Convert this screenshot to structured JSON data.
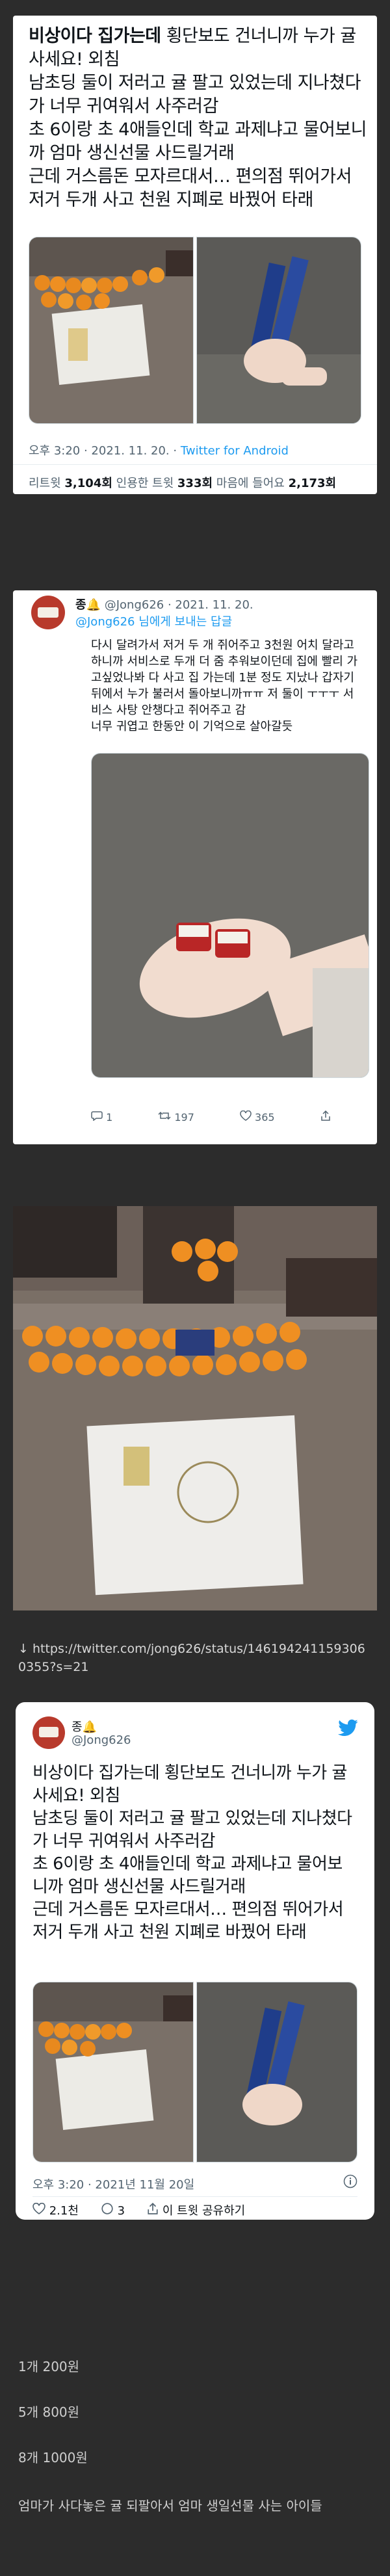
{
  "tweet1": {
    "text_bold": "비상이다 집가는데",
    "text_rest": " 횡단보도 건너니까 누가 귤사세요! 외침\n남초딩 둘이 저러고 귤 팔고 있었는데 지나쳤다가 너무 귀여워서 사주러감\n초 6이랑 초 4애들인데 학교 과제냐고 물어보니까 엄마 생신선물 사드릴거래\n근데 거스름돈 모자르대서… 편의점 뛰어가서 저거 두개 사고 천원 지폐로 바꿨어 타래",
    "timestamp": "오후 3:20 · 2021. 11. 20. · ",
    "source": "Twitter for Android",
    "retweets_count": "3,104회",
    "retweets_label": " 리트윗 ",
    "quotes_count": "333회",
    "quotes_label": " 인용한 트윗 ",
    "likes_count": "2,173회",
    "likes_label": " 마음에 들어요 "
  },
  "reply": {
    "name": "종🔔",
    "handle": "@Jong626 · 2021. 11. 20.",
    "replying_to": "@Jong626 님에게 보내는 답글",
    "text": "다시 달려가서 저거 두 개 쥐어주고 3천원 어치 달라고 하니까 서비스로 두개 더 줌 추워보이던데 집에 빨리 가고싶었나봐 다 사고 집 가는데 1분 정도 지났나 갑자기 뒤에서 누가 불러서 돌아보니까ㅠㅠ 저 둘이 ㅜㅜㅜ 서비스 사탕 안챙다고 쥐어주고 감\n너무 귀엽고 한동안 이 기억으로 살아갈듯",
    "reply_count": "1",
    "retweet_count": "197",
    "like_count": "365"
  },
  "link_caption": "↓ https://twitter.com/jong626/status/1461942411593060355?s=21",
  "tweet2": {
    "name": "종🔔",
    "handle": "@Jong626",
    "text": "비상이다 집가는데 횡단보도 건너니까 누가 귤사세요! 외침\n남초딩 둘이 저러고 귤 팔고 있었는데 지나쳤다가 너무 귀여워서 사주러감\n초 6이랑 초 4애들인데 학교 과제냐고 물어보니까 엄마 생신선물 사드릴거래\n근데 거스름돈 모자르대서… 편의점 뛰어가서 저거 두개 사고 천원 지폐로 바꿨어 타래",
    "timestamp": "오후 3:20 · 2021년 11월 20일",
    "likes": "2.1천",
    "replies": "3",
    "share": "이 트윗 공유하기"
  },
  "price_list": [
    "1개 200원",
    "5개 800원",
    "8개 1000원"
  ],
  "footer_text": "엄마가 사다놓은 귤 되팔아서 엄마 생일선물 사는 아이들",
  "colors": {
    "twitter_blue": "#1d9bf0",
    "page_bg": "#2c2c2c"
  }
}
